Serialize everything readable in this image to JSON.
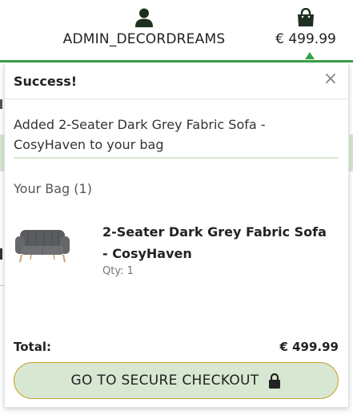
{
  "header": {
    "account_icon": "user-icon",
    "account_name": "ADMIN_DECORDREAMS",
    "bag_icon": "shopping-bag-icon",
    "bag_total": "€ 499.99"
  },
  "toast": {
    "title": "Success!",
    "close_label": "×",
    "message": "Added 2-Seater Dark Grey Fabric Sofa - CosyHaven to your bag",
    "bag_heading": "Your Bag (1)",
    "items": [
      {
        "name": "2-Seater Dark Grey Fabric Sofa - CosyHaven",
        "qty": "Qty: 1",
        "image_icon": "sofa-image"
      }
    ],
    "total_label": "Total:",
    "total_value": "€ 499.99",
    "checkout_label": "GO TO SECURE CHECKOUT",
    "checkout_icon": "lock-icon"
  },
  "colors": {
    "accent_green": "#3aa046",
    "button_bg": "#d8e7d2",
    "button_border": "#c8a032"
  }
}
